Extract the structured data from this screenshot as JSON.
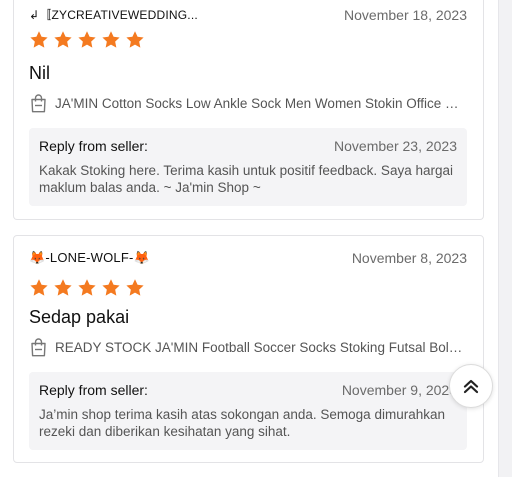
{
  "colors": {
    "star": "#f47a20",
    "text": "#222222",
    "muted": "#6b6b6b",
    "reply_bg": "#f4f4f6"
  },
  "reviews": [
    {
      "user": "↲〚ZYCREATIVEWEDDING...",
      "date": "November 18, 2023",
      "rating": 5,
      "title": "Nil",
      "product_icon": "shopping-bag-icon",
      "product": "JA'MIN Cotton Socks Low Ankle Sock Men Women Stokin Office Socks",
      "reply_label": "Reply from seller:",
      "reply_date": "November 23, 2023",
      "reply_text": "Kakak Stoking here. Terima kasih untuk positif feedback. Saya hargai maklum balas anda. ~ Ja'min Shop ~"
    },
    {
      "user": "🦊-LONE-WOLF-🦊",
      "date": "November 8, 2023",
      "rating": 5,
      "title": "Sedap pakai",
      "product_icon": "shopping-bag-icon",
      "product": "READY STOCK JA'MIN Football Soccer Socks Stoking Futsal Bola Dewasa",
      "reply_label": "Reply from seller:",
      "reply_date": "November 9, 2023",
      "reply_text": "Ja’min shop terima kasih atas sokongan anda. Semoga dimurahkan rezeki dan diberikan kesihatan yang sihat."
    }
  ],
  "scroll_top": {
    "icon": "double-chevron-up-icon"
  }
}
